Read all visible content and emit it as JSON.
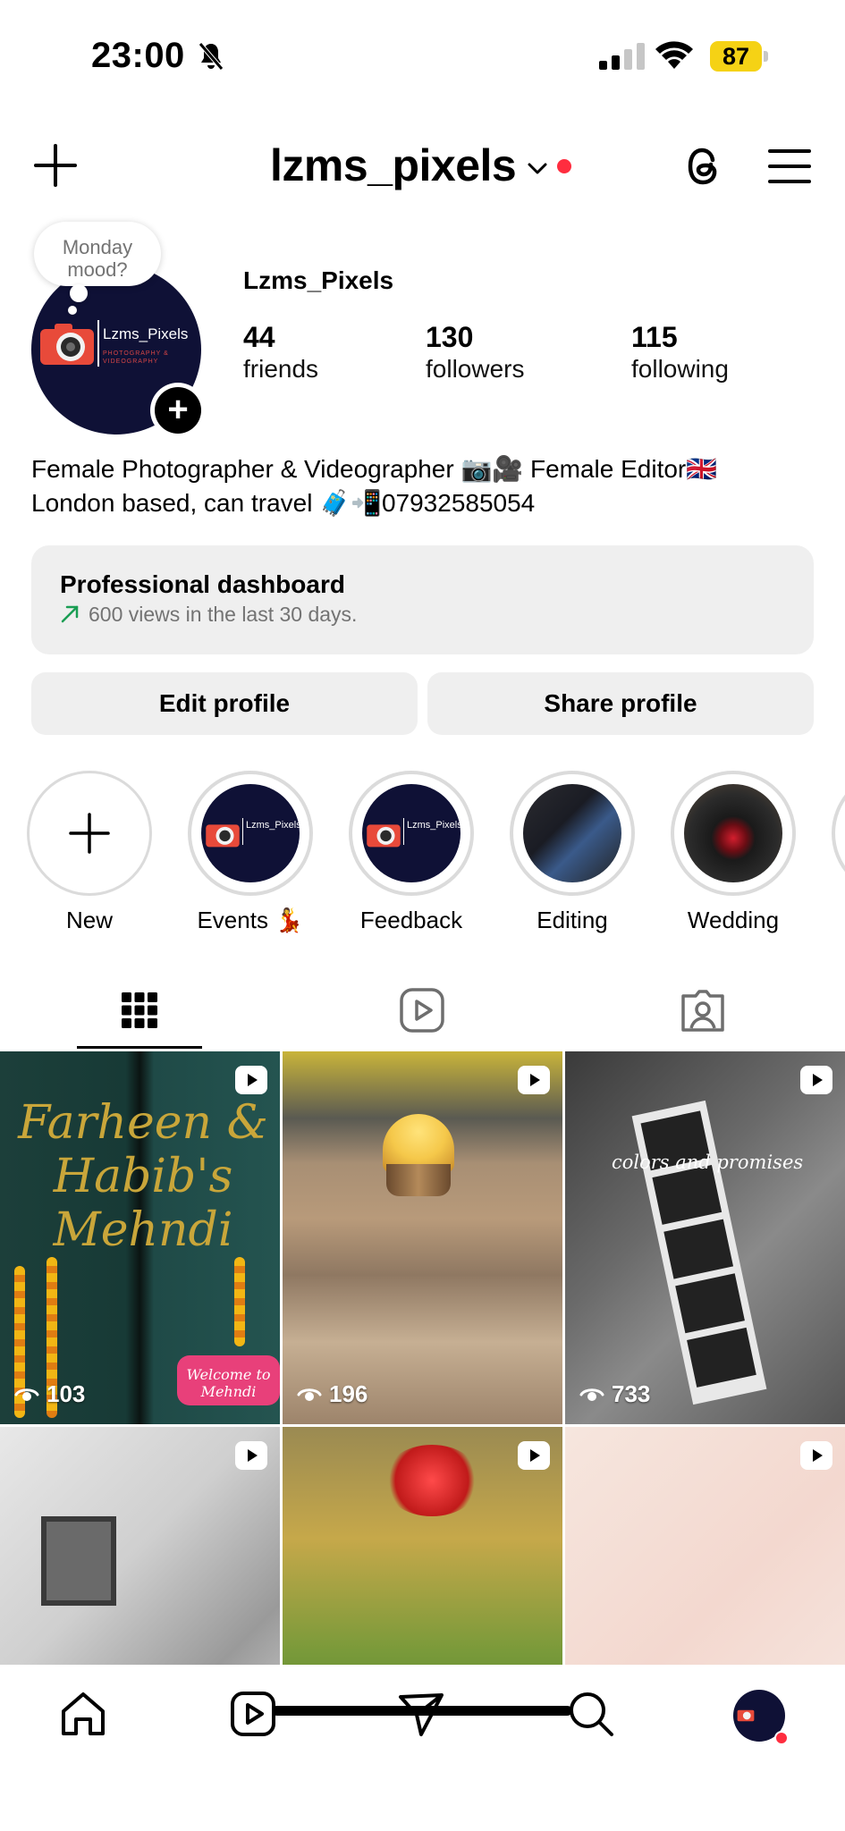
{
  "status_bar": {
    "time": "23:00",
    "battery": "87",
    "icons": [
      "bell-slash-icon",
      "cellular-signal-icon",
      "wifi-icon",
      "battery-icon"
    ]
  },
  "header": {
    "username": "lzms_pixels",
    "icons": [
      "plus-icon",
      "chevron-down-icon",
      "threads-icon",
      "menu-icon"
    ]
  },
  "profile": {
    "note": "Monday mood?",
    "avatar_text": "Lzms_Pixels",
    "avatar_subtext": "PHOTOGRAPHY & VIDEOGRAPHY",
    "display_name": "Lzms_Pixels",
    "stats": [
      {
        "value": "44",
        "label": "friends"
      },
      {
        "value": "130",
        "label": "followers"
      },
      {
        "value": "115",
        "label": "following"
      }
    ],
    "bio_line1": "Female Photographer & Videographer 📷🎥 Female Editor🇬🇧",
    "bio_line2": "London based, can travel 🧳📲07932585054"
  },
  "dashboard": {
    "title": "Professional dashboard",
    "subtitle": "600 views in the last 30 days."
  },
  "buttons": {
    "edit": "Edit profile",
    "share": "Share profile"
  },
  "highlights": [
    {
      "label": "New"
    },
    {
      "label": "Events 💃"
    },
    {
      "label": "Feedback"
    },
    {
      "label": "Editing"
    },
    {
      "label": "Wedding"
    }
  ],
  "grid": {
    "tiles": [
      {
        "views": "103",
        "text": "Farheen & Habib's Mehndi",
        "sticker": "Welcome to Mehndi"
      },
      {
        "views": "196"
      },
      {
        "views": "733",
        "text": "colors and promises"
      },
      {
        "views": ""
      },
      {
        "views": ""
      },
      {
        "views": ""
      }
    ]
  },
  "colors": {
    "accent_red": "#ff2d3f",
    "battery_yellow": "#f5d215",
    "button_bg": "#efefef",
    "trend_green": "#1a9e54"
  }
}
